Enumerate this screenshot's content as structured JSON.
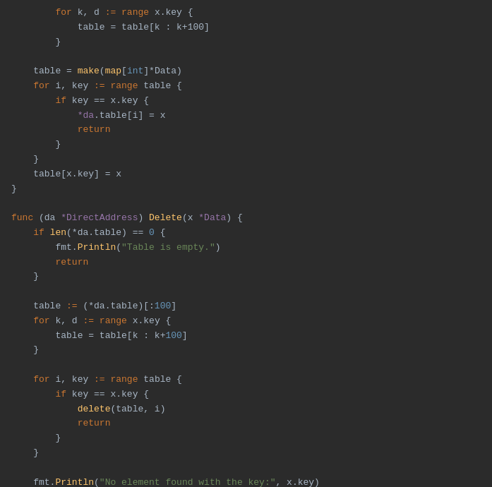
{
  "code": {
    "lines": [
      {
        "id": 1,
        "indent": 2,
        "tokens": [
          {
            "t": "kw",
            "v": "for"
          },
          {
            "t": "plain",
            "v": " k, d "
          },
          {
            "t": "kw",
            "v": ":="
          },
          {
            "t": "plain",
            "v": " "
          },
          {
            "t": "kw",
            "v": "range"
          },
          {
            "t": "plain",
            "v": " x.key {"
          }
        ]
      },
      {
        "id": 2,
        "indent": 3,
        "tokens": [
          {
            "t": "plain",
            "v": "table = table[k : k+100]"
          }
        ]
      },
      {
        "id": 3,
        "indent": 2,
        "tokens": [
          {
            "t": "plain",
            "v": "}"
          }
        ]
      },
      {
        "id": 4,
        "indent": 0,
        "tokens": []
      },
      {
        "id": 5,
        "indent": 1,
        "tokens": [
          {
            "t": "plain",
            "v": "table = "
          },
          {
            "t": "fn",
            "v": "make"
          },
          {
            "t": "plain",
            "v": "("
          },
          {
            "t": "fn",
            "v": "map"
          },
          {
            "t": "plain",
            "v": "["
          },
          {
            "t": "type",
            "v": "int"
          },
          {
            "t": "plain",
            "v": "]*Data)"
          }
        ]
      },
      {
        "id": 6,
        "indent": 1,
        "tokens": [
          {
            "t": "kw",
            "v": "for"
          },
          {
            "t": "plain",
            "v": " i, key "
          },
          {
            "t": "kw",
            "v": ":="
          },
          {
            "t": "plain",
            "v": " "
          },
          {
            "t": "kw",
            "v": "range"
          },
          {
            "t": "plain",
            "v": " table {"
          }
        ]
      },
      {
        "id": 7,
        "indent": 2,
        "tokens": [
          {
            "t": "kw",
            "v": "if"
          },
          {
            "t": "plain",
            "v": " key "
          },
          {
            "t": "op",
            "v": "=="
          },
          {
            "t": "plain",
            "v": " x.key {"
          }
        ]
      },
      {
        "id": 8,
        "indent": 3,
        "tokens": [
          {
            "t": "var",
            "v": "*da"
          },
          {
            "t": "plain",
            "v": ".table[i] = x"
          }
        ]
      },
      {
        "id": 9,
        "indent": 3,
        "tokens": [
          {
            "t": "kw",
            "v": "return"
          }
        ]
      },
      {
        "id": 10,
        "indent": 2,
        "tokens": [
          {
            "t": "plain",
            "v": "}"
          }
        ]
      },
      {
        "id": 11,
        "indent": 1,
        "tokens": [
          {
            "t": "plain",
            "v": "}"
          }
        ]
      },
      {
        "id": 12,
        "indent": 1,
        "tokens": [
          {
            "t": "plain",
            "v": "table[x.key] = x"
          }
        ]
      },
      {
        "id": 13,
        "indent": 0,
        "tokens": [
          {
            "t": "plain",
            "v": "}"
          }
        ]
      },
      {
        "id": 14,
        "indent": 0,
        "tokens": []
      },
      {
        "id": 15,
        "indent": 0,
        "tokens": [
          {
            "t": "kw",
            "v": "func"
          },
          {
            "t": "plain",
            "v": " (da "
          },
          {
            "t": "var",
            "v": "*DirectAddress"
          },
          {
            "t": "plain",
            "v": ") "
          },
          {
            "t": "fn",
            "v": "Delete"
          },
          {
            "t": "plain",
            "v": "(x "
          },
          {
            "t": "var",
            "v": "*Data"
          },
          {
            "t": "plain",
            "v": ") {"
          }
        ]
      },
      {
        "id": 16,
        "indent": 1,
        "tokens": [
          {
            "t": "kw",
            "v": "if"
          },
          {
            "t": "plain",
            "v": " "
          },
          {
            "t": "fn",
            "v": "len"
          },
          {
            "t": "plain",
            "v": "(*da.table) "
          },
          {
            "t": "op",
            "v": "=="
          },
          {
            "t": "plain",
            "v": " "
          },
          {
            "t": "num",
            "v": "0"
          },
          {
            "t": "plain",
            "v": " {"
          }
        ]
      },
      {
        "id": 17,
        "indent": 2,
        "tokens": [
          {
            "t": "plain",
            "v": "fmt."
          },
          {
            "t": "fn",
            "v": "Println"
          },
          {
            "t": "plain",
            "v": "("
          },
          {
            "t": "str",
            "v": "\"Table is empty.\""
          },
          {
            "t": "plain",
            "v": ")"
          }
        ]
      },
      {
        "id": 18,
        "indent": 2,
        "tokens": [
          {
            "t": "kw",
            "v": "return"
          }
        ]
      },
      {
        "id": 19,
        "indent": 1,
        "tokens": [
          {
            "t": "plain",
            "v": "}"
          }
        ]
      },
      {
        "id": 20,
        "indent": 0,
        "tokens": []
      },
      {
        "id": 21,
        "indent": 1,
        "tokens": [
          {
            "t": "plain",
            "v": "table "
          },
          {
            "t": "kw",
            "v": ":="
          },
          {
            "t": "plain",
            "v": " (*da.table)[:"
          },
          {
            "t": "num",
            "v": "100"
          },
          {
            "t": "plain",
            "v": "]"
          }
        ]
      },
      {
        "id": 22,
        "indent": 1,
        "tokens": [
          {
            "t": "kw",
            "v": "for"
          },
          {
            "t": "plain",
            "v": " k, d "
          },
          {
            "t": "kw",
            "v": ":="
          },
          {
            "t": "plain",
            "v": " "
          },
          {
            "t": "kw",
            "v": "range"
          },
          {
            "t": "plain",
            "v": " x.key {"
          }
        ]
      },
      {
        "id": 23,
        "indent": 2,
        "tokens": [
          {
            "t": "plain",
            "v": "table = table[k : k+"
          },
          {
            "t": "num",
            "v": "100"
          },
          {
            "t": "plain",
            "v": "]"
          }
        ]
      },
      {
        "id": 24,
        "indent": 1,
        "tokens": [
          {
            "t": "plain",
            "v": "}"
          }
        ]
      },
      {
        "id": 25,
        "indent": 0,
        "tokens": []
      },
      {
        "id": 26,
        "indent": 1,
        "tokens": [
          {
            "t": "kw",
            "v": "for"
          },
          {
            "t": "plain",
            "v": " i, key "
          },
          {
            "t": "kw",
            "v": ":="
          },
          {
            "t": "plain",
            "v": " "
          },
          {
            "t": "kw",
            "v": "range"
          },
          {
            "t": "plain",
            "v": " table {"
          }
        ]
      },
      {
        "id": 27,
        "indent": 2,
        "tokens": [
          {
            "t": "kw",
            "v": "if"
          },
          {
            "t": "plain",
            "v": " key "
          },
          {
            "t": "op",
            "v": "=="
          },
          {
            "t": "plain",
            "v": " x.key {"
          }
        ]
      },
      {
        "id": 28,
        "indent": 3,
        "tokens": [
          {
            "t": "fn",
            "v": "delete"
          },
          {
            "t": "plain",
            "v": "(table, i)"
          }
        ]
      },
      {
        "id": 29,
        "indent": 3,
        "tokens": [
          {
            "t": "kw",
            "v": "return"
          }
        ]
      },
      {
        "id": 30,
        "indent": 2,
        "tokens": [
          {
            "t": "plain",
            "v": "}"
          }
        ]
      },
      {
        "id": 31,
        "indent": 1,
        "tokens": [
          {
            "t": "plain",
            "v": "}"
          }
        ]
      },
      {
        "id": 32,
        "indent": 0,
        "tokens": []
      },
      {
        "id": 33,
        "indent": 1,
        "tokens": [
          {
            "t": "plain",
            "v": "fmt."
          },
          {
            "t": "fn",
            "v": "Println"
          },
          {
            "t": "plain",
            "v": "("
          },
          {
            "t": "str",
            "v": "\"No element found with the key:\""
          },
          {
            "t": "plain",
            "v": ", x.key)"
          }
        ]
      }
    ]
  }
}
